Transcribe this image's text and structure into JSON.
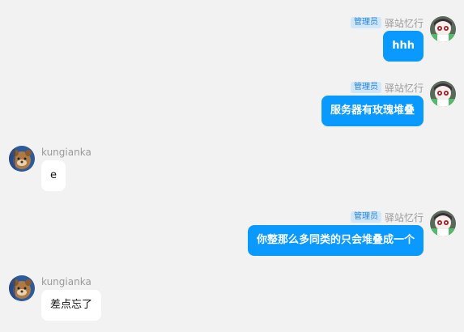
{
  "messages": [
    {
      "side": "right",
      "sender": "驿站忆行",
      "role_badge": "管理员",
      "text": "hhh",
      "avatar": "anime-girl-avatar-icon"
    },
    {
      "side": "right",
      "sender": "驿站忆行",
      "role_badge": "管理员",
      "text": "服务器有玫瑰堆叠",
      "avatar": "anime-girl-avatar-icon"
    },
    {
      "side": "left",
      "sender": "kungianka",
      "text": "e",
      "avatar": "bear-avatar-icon"
    },
    {
      "side": "right",
      "sender": "驿站忆行",
      "role_badge": "管理员",
      "text": "你整那么多同类的只会堆叠成一个",
      "avatar": "anime-girl-avatar-icon"
    },
    {
      "side": "left",
      "sender": "kungianka",
      "text": "差点忘了",
      "avatar": "bear-avatar-icon"
    }
  ],
  "colors": {
    "background": "#f2f2f2",
    "self_bubble": "#0a99ff",
    "other_bubble": "#ffffff",
    "badge_bg": "#cfe6fb",
    "badge_text": "#2a86d6",
    "name_text": "#9a9a9a"
  }
}
